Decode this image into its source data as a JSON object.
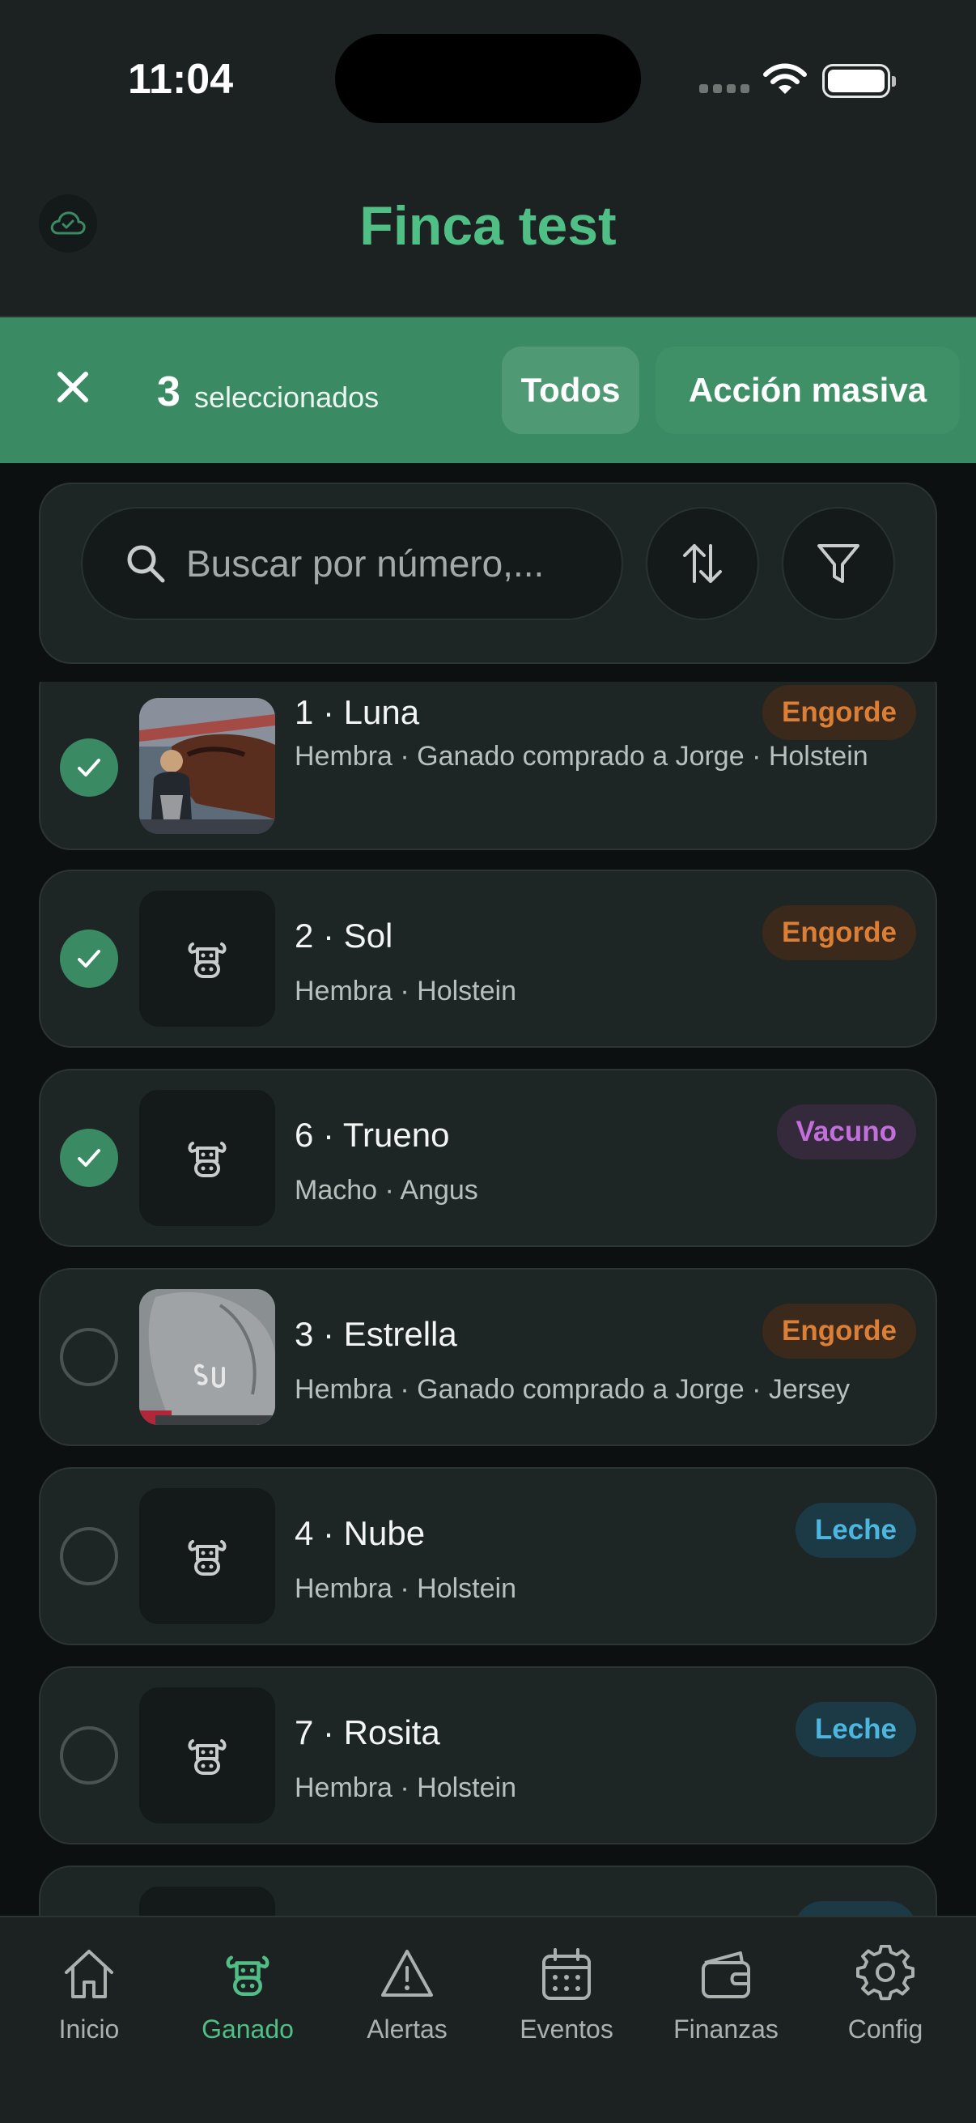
{
  "status": {
    "time": "11:04"
  },
  "header": {
    "title": "Finca test"
  },
  "selection": {
    "count": "3",
    "label": "seleccionados",
    "all_label": "Todos",
    "bulk_label": "Acción masiva"
  },
  "search": {
    "placeholder": "Buscar por número,..."
  },
  "animals": [
    {
      "title": "1 · Luna",
      "meta": "Hembra · Ganado comprado a Jorge · Holstein",
      "badge": "Engorde",
      "selected": true,
      "thumb": "photo-horse"
    },
    {
      "title": "2 · Sol",
      "meta": "Hembra · Holstein",
      "badge": "Engorde",
      "selected": true,
      "thumb": "cow-icon"
    },
    {
      "title": "6 · Trueno",
      "meta": "Macho · Angus",
      "badge": "Vacuno",
      "selected": true,
      "thumb": "cow-icon"
    },
    {
      "title": "3 · Estrella",
      "meta": "Hembra · Ganado comprado a Jorge · Jersey",
      "badge": "Engorde",
      "selected": false,
      "thumb": "photo-cow-hide"
    },
    {
      "title": "4 · Nube",
      "meta": "Hembra · Holstein",
      "badge": "Leche",
      "selected": false,
      "thumb": "cow-icon"
    },
    {
      "title": "7 · Rosita",
      "meta": "Hembra · Holstein",
      "badge": "Leche",
      "selected": false,
      "thumb": "cow-icon"
    }
  ],
  "tabs": [
    {
      "label": "Inicio",
      "icon": "home-icon",
      "active": false
    },
    {
      "label": "Ganado",
      "icon": "cow-icon",
      "active": true
    },
    {
      "label": "Alertas",
      "icon": "alert-icon",
      "active": false
    },
    {
      "label": "Eventos",
      "icon": "calendar-icon",
      "active": false
    },
    {
      "label": "Finanzas",
      "icon": "wallet-icon",
      "active": false
    },
    {
      "label": "Config",
      "icon": "gear-icon",
      "active": false
    }
  ],
  "colors": {
    "accent": "#4fbf85",
    "selection_bar": "#3a8a63",
    "engorde": "#dc7f36",
    "vacuno": "#c36fdb",
    "leche": "#4cb6de"
  }
}
